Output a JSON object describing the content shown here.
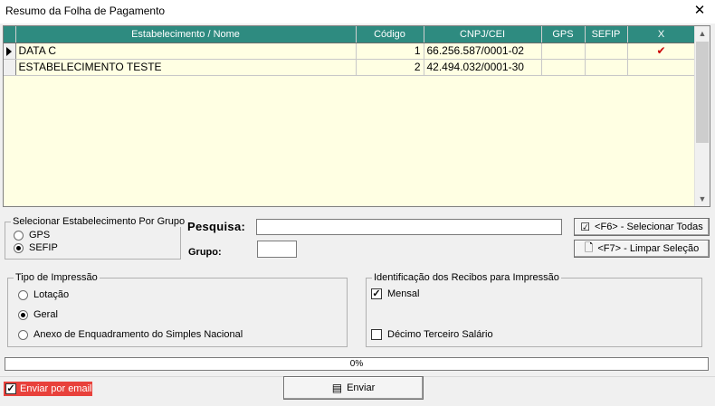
{
  "window": {
    "title": "Resumo da Folha de Pagamento",
    "close_glyph": "✕"
  },
  "grid": {
    "columns": [
      "Estabelecimento / Nome",
      "Código",
      "CNPJ/CEI",
      "GPS",
      "SEFIP",
      "X"
    ],
    "rows": [
      {
        "nome": "DATA C",
        "codigo": "1",
        "cnpj": "66.256.587/0001-02",
        "gps": "",
        "sefip": "",
        "x": "✔"
      },
      {
        "nome": "ESTABELECIMENTO TESTE",
        "codigo": "2",
        "cnpj": "42.494.032/0001-30",
        "gps": "",
        "sefip": "",
        "x": ""
      }
    ]
  },
  "group_selector": {
    "legend": "Selecionar Estabelecimento Por Grupo",
    "options": [
      {
        "label": "GPS",
        "selected": false
      },
      {
        "label": "SEFIP",
        "selected": true
      }
    ]
  },
  "search": {
    "pesquisa_label": "Pesquisa:",
    "pesquisa_value": "",
    "grupo_label": "Grupo:",
    "grupo_value": ""
  },
  "buttons": {
    "select_all": "<F6> - Selecionar Todas",
    "clear_selection": "<F7> - Limpar Seleção",
    "send": "Enviar"
  },
  "print_type": {
    "legend": "Tipo de Impressão",
    "options": [
      {
        "label": "Lotação",
        "selected": false
      },
      {
        "label": "Geral",
        "selected": true
      },
      {
        "label": "Anexo de Enquadramento do Simples Nacional",
        "selected": false
      }
    ]
  },
  "receipts": {
    "legend": "Identificação dos Recibos para Impressão",
    "options": [
      {
        "label": "Mensal",
        "checked": true
      },
      {
        "label": "Décimo Terceiro Salário",
        "checked": false
      }
    ]
  },
  "progress": {
    "value": 0,
    "label": "0%"
  },
  "email": {
    "label": "Enviar por email",
    "checked": true
  }
}
